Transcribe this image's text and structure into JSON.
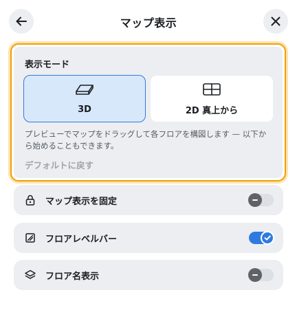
{
  "header": {
    "title": "マップ表示",
    "back_icon": "arrow-left-icon",
    "close_icon": "close-icon"
  },
  "display_mode": {
    "label": "表示モード",
    "selected": "3D",
    "options": [
      {
        "label": "3D",
        "icon": "3d-box-icon",
        "selected": true
      },
      {
        "label": "2D 真上から",
        "icon": "grid-top-view-icon",
        "selected": false
      }
    ],
    "description": "プレビューでマップをドラッグして各フロアを構図します — 以下から始めることもできます。",
    "reset_label": "デフォルトに戻す"
  },
  "settings": [
    {
      "label": "マップ表示を固定",
      "icon": "lock-icon",
      "enabled": false
    },
    {
      "label": "フロアレベルバー",
      "icon": "level-bar-icon",
      "enabled": true
    },
    {
      "label": "フロア名表示",
      "icon": "layers-icon",
      "enabled": false
    }
  ],
  "colors": {
    "accent": "#2f7ae0",
    "focus_outline": "#f0a000",
    "panel_bg": "#eceef1"
  }
}
